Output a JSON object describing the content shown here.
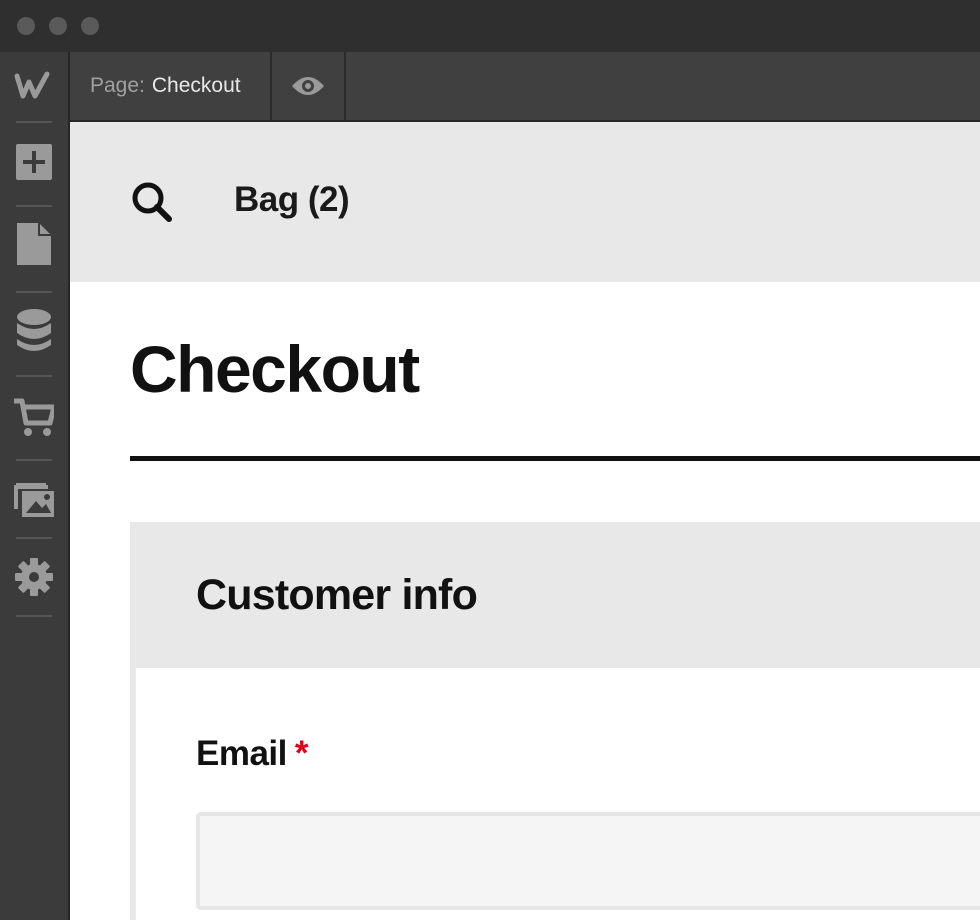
{
  "toolbar": {
    "page_prefix": "Page:",
    "page_name": "Checkout"
  },
  "sidebar": {
    "items": [
      {
        "icon": "webflow-logo-icon"
      },
      {
        "icon": "add-panel-icon"
      },
      {
        "icon": "pages-icon"
      },
      {
        "icon": "cms-database-icon"
      },
      {
        "icon": "ecommerce-cart-icon"
      },
      {
        "icon": "assets-images-icon"
      },
      {
        "icon": "settings-gear-icon"
      }
    ]
  },
  "header": {
    "bag_label": "Bag (2)"
  },
  "main": {
    "title": "Checkout",
    "customer_info": {
      "title": "Customer info",
      "email_label": "Email",
      "required_mark": "*",
      "email_value": "",
      "email_placeholder": ""
    }
  },
  "colors": {
    "required": "#e0001b",
    "header_bg": "#e8e8e8",
    "chrome_bg": "#3b3b3b"
  }
}
